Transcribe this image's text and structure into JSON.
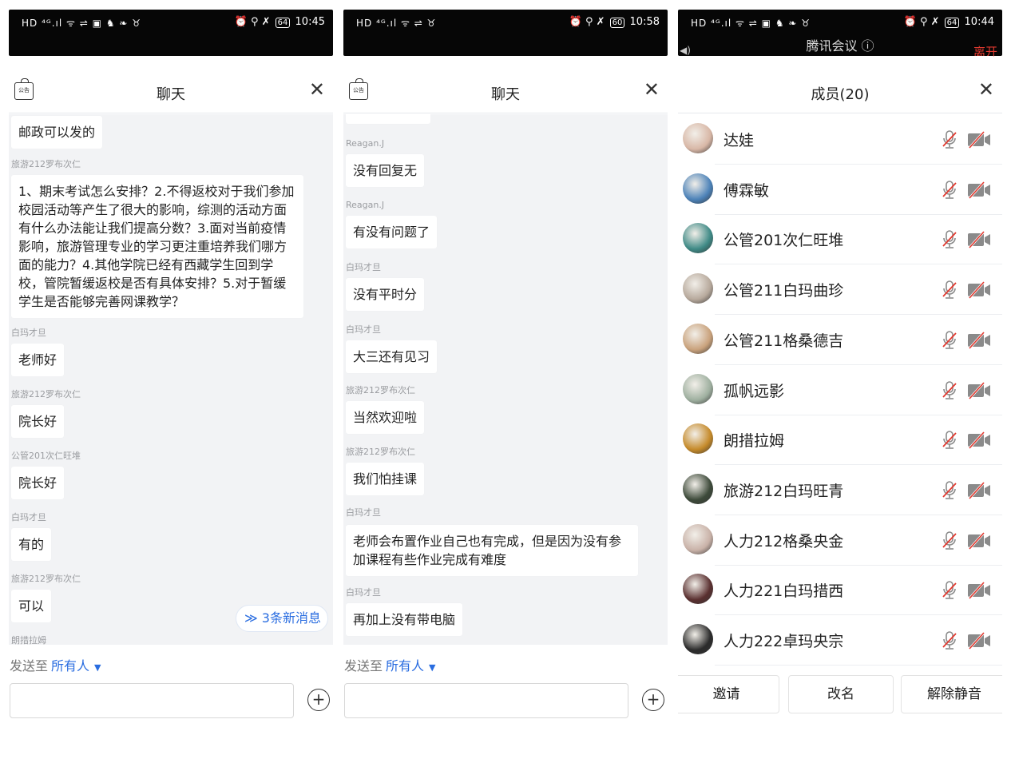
{
  "colors": {
    "accent": "#2a6de0",
    "danger": "#e23a30",
    "chat_bg": "#f2f3f5"
  },
  "panels": [
    {
      "status": {
        "left": "HD ⁴ᴳ.ıl ᯤ ⇌ ▣ ♞ ❧ ♉",
        "right_icons": "⏰ ⚲ ✗",
        "battery": "64",
        "time": "10:45"
      },
      "header": {
        "title": "聊天",
        "notice_icon_text": "公告",
        "close_label": "✕"
      },
      "messages": [
        {
          "sender": "",
          "text": "邮政可以发的"
        },
        {
          "sender": "旅游212罗布次仁",
          "text": "1、期末考试怎么安排？2.不得返校对于我们参加校园活动等产生了很大的影响，综测的活动方面有什么办法能让我们提高分数？3.面对当前疫情影响，旅游管理专业的学习更注重培养我们哪方面的能力？4.其他学院已经有西藏学生回到学校，管院暂缓返校是否有具体安排？5.对于暂缓学生是否能够完善网课教学？"
        },
        {
          "sender": "白玛才旦",
          "text": "老师好"
        },
        {
          "sender": "旅游212罗布次仁",
          "text": "院长好"
        },
        {
          "sender": "公管201次仁旺堆",
          "text": "院长好"
        },
        {
          "sender": "白玛才旦",
          "text": "有的"
        },
        {
          "sender": "旅游212罗布次仁",
          "text": "可以"
        },
        {
          "sender": "朗措拉姆",
          "text": ""
        }
      ],
      "new_messages": "≫ 3条新消息",
      "send": {
        "prefix": "发送至",
        "target": "所有人",
        "plus": "+"
      }
    },
    {
      "status": {
        "left": "HD ⁴ᴳ.ıl ᯤ ⇌ ♉",
        "right_icons": "⏰ ⚲ ✗",
        "battery": "60",
        "time": "10:58"
      },
      "header": {
        "title": "聊天",
        "notice_icon_text": "公告",
        "close_label": "✕"
      },
      "messages": [
        {
          "sender": "Reagan.J",
          "text": "没有回复无"
        },
        {
          "sender": "Reagan.J",
          "text": "有没有问题了"
        },
        {
          "sender": "白玛才旦",
          "text": "没有平时分"
        },
        {
          "sender": "白玛才旦",
          "text": "大三还有见习"
        },
        {
          "sender": "旅游212罗布次仁",
          "text": "当然欢迎啦"
        },
        {
          "sender": "旅游212罗布次仁",
          "text": "我们怕挂课"
        },
        {
          "sender": "白玛才旦",
          "text": "老师会布置作业自己也有完成，但是因为没有参加课程有些作业完成有难度"
        },
        {
          "sender": "白玛才旦",
          "text": "再加上没有带电脑"
        }
      ],
      "send": {
        "prefix": "发送至",
        "target": "所有人",
        "plus": "+"
      }
    },
    {
      "status": {
        "left": "HD ⁴ᴳ.ıl ᯤ ⇌ ▣ ♞ ❧ ♉",
        "right_icons": "⏰ ⚲ ✗",
        "battery": "64",
        "time": "10:44"
      },
      "meeting": {
        "title": "腾讯会议 ⓘ",
        "leave": "离开"
      },
      "header": {
        "title": "成员(20)",
        "close_label": "✕"
      },
      "members": [
        {
          "name": "达娃",
          "avatar_color": "#d8b7a6"
        },
        {
          "name": "傅霖敏",
          "avatar_color": "#4c82b8"
        },
        {
          "name": "公管201次仁旺堆",
          "avatar_color": "#3f8a86"
        },
        {
          "name": "公管211白玛曲珍",
          "avatar_color": "#b7a99c"
        },
        {
          "name": "公管211格桑德吉",
          "avatar_color": "#c9a27c"
        },
        {
          "name": "孤帆远影",
          "avatar_color": "#9fb0a0"
        },
        {
          "name": "朗措拉姆",
          "avatar_color": "#c58a2a"
        },
        {
          "name": "旅游212白玛旺青",
          "avatar_color": "#3d4a3a"
        },
        {
          "name": "人力212格桑央金",
          "avatar_color": "#c9b2a8"
        },
        {
          "name": "人力221白玛措西",
          "avatar_color": "#5a3030"
        },
        {
          "name": "人力222卓玛央宗",
          "avatar_color": "#2b2b2b"
        }
      ],
      "buttons": {
        "invite": "邀请",
        "rename": "改名",
        "unmute": "解除静音"
      }
    }
  ]
}
